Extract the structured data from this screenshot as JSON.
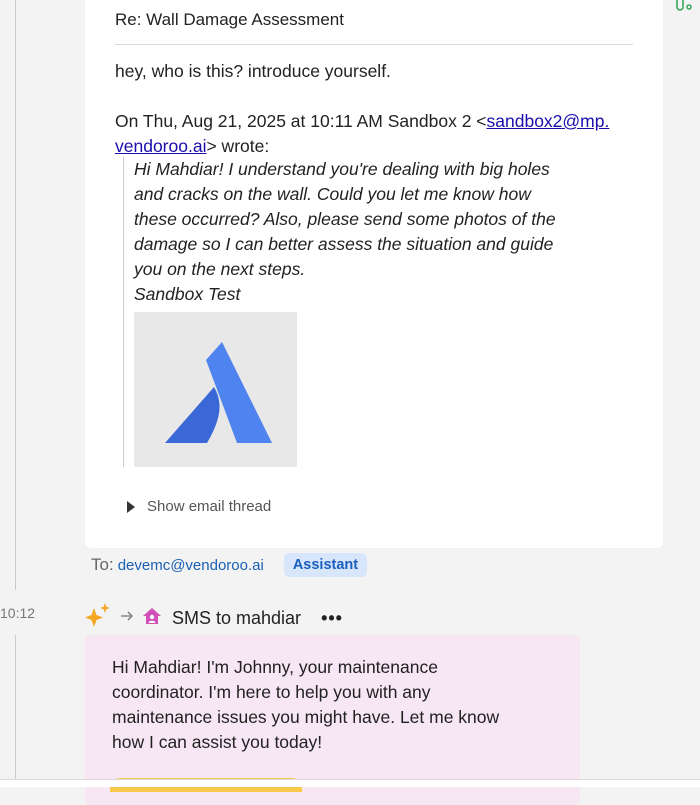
{
  "email": {
    "subject": "Re: Wall Damage Assessment",
    "reply_text": "hey, who is this? introduce yourself.",
    "quote_header_prefix": "On Thu, Aug 21, 2025 at 10:11 AM Sandbox 2 <",
    "quote_link_part1": "sandbox2@mp.",
    "quote_link_part2": "vendoroo.ai",
    "quote_header_suffix": "> wrote:",
    "quoted_lines": [
      "Hi Mahdiar! I understand you're dealing with big holes",
      "and cracks on the wall. Could you let me know how",
      "these occurred? Also, please send some photos of the",
      "damage so I can better assess the situation and guide",
      "you on the next steps.",
      "Sandbox Test"
    ],
    "show_thread_label": "Show email thread"
  },
  "recipients": {
    "to_label": "To:",
    "to_email": "devemc@vendoroo.ai",
    "badge": "Assistant"
  },
  "sms": {
    "timestamp": "10:12",
    "title": "SMS to mahdiar",
    "more_label": "•••",
    "lines": [
      "Hi Mahdiar! I'm Johnny, your maintenance",
      "coordinator. I'm here to help you with any",
      "maintenance issues you might have. Let me know",
      "how I can assist you today!"
    ]
  },
  "colors": {
    "brand_blue": "#4f83f0",
    "brand_blue_dark": "#3a68d6",
    "sparkle": "#f5a623",
    "house_pink": "#d14fb7",
    "sms_bg": "#f7e6f3",
    "badge_bg": "#d7e6fb"
  }
}
